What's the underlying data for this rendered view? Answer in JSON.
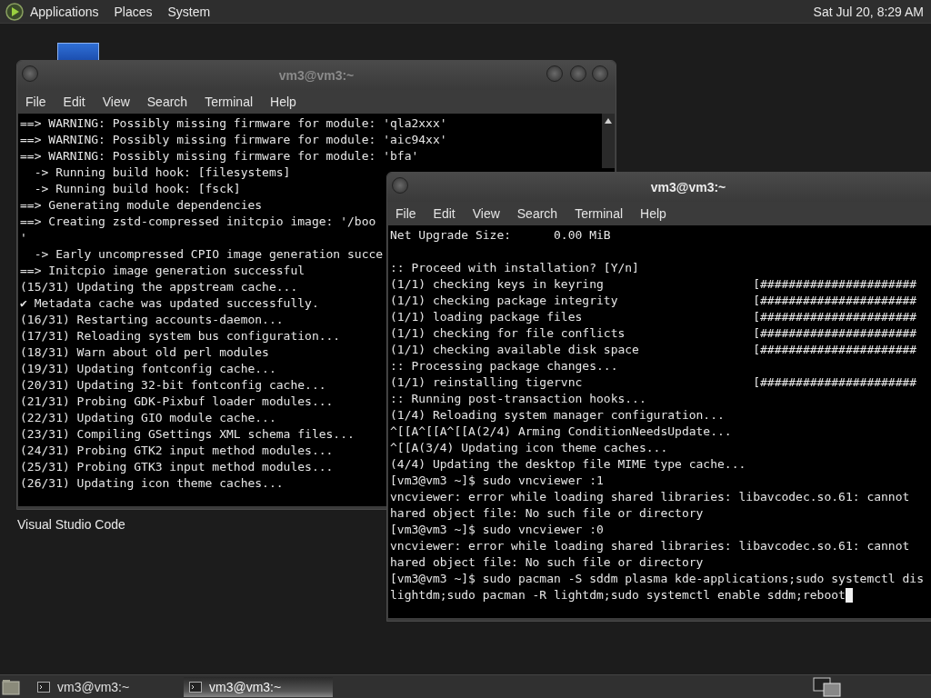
{
  "top_panel": {
    "menus": [
      "Applications",
      "Places",
      "System"
    ],
    "clock": "Sat Jul 20,  8:29 AM"
  },
  "desktop_icons": [
    {
      "label": "Visual Studio Code"
    }
  ],
  "windows": [
    {
      "title": "vm3@vm3:~",
      "active": false,
      "menu": [
        "File",
        "Edit",
        "View",
        "Search",
        "Terminal",
        "Help"
      ],
      "lines": [
        {
          "kind": "text",
          "text": "==> WARNING: Possibly missing firmware for module: 'qla2xxx'"
        },
        {
          "kind": "text",
          "text": "==> WARNING: Possibly missing firmware for module: 'aic94xx'"
        },
        {
          "kind": "text",
          "text": "==> WARNING: Possibly missing firmware for module: 'bfa'"
        },
        {
          "kind": "text",
          "text": "  -> Running build hook: [filesystems]"
        },
        {
          "kind": "text",
          "text": "  -> Running build hook: [fsck]"
        },
        {
          "kind": "text",
          "text": "==> Generating module dependencies"
        },
        {
          "kind": "text",
          "text": "==> Creating zstd-compressed initcpio image: '/boo"
        },
        {
          "kind": "text",
          "text": "'"
        },
        {
          "kind": "text",
          "text": "  -> Early uncompressed CPIO image generation succe"
        },
        {
          "kind": "text",
          "text": "==> Initcpio image generation successful"
        },
        {
          "kind": "text",
          "text": "(15/31) Updating the appstream cache..."
        },
        {
          "kind": "text",
          "text": "✔ Metadata cache was updated successfully."
        },
        {
          "kind": "text",
          "text": "(16/31) Restarting accounts-daemon..."
        },
        {
          "kind": "text",
          "text": "(17/31) Reloading system bus configuration..."
        },
        {
          "kind": "text",
          "text": "(18/31) Warn about old perl modules"
        },
        {
          "kind": "text",
          "text": "(19/31) Updating fontconfig cache..."
        },
        {
          "kind": "text",
          "text": "(20/31) Updating 32-bit fontconfig cache..."
        },
        {
          "kind": "text",
          "text": "(21/31) Probing GDK-Pixbuf loader modules..."
        },
        {
          "kind": "text",
          "text": "(22/31) Updating GIO module cache..."
        },
        {
          "kind": "text",
          "text": "(23/31) Compiling GSettings XML schema files..."
        },
        {
          "kind": "text",
          "text": "(24/31) Probing GTK2 input method modules..."
        },
        {
          "kind": "text",
          "text": "(25/31) Probing GTK3 input method modules..."
        },
        {
          "kind": "text",
          "text": "(26/31) Updating icon theme caches..."
        }
      ]
    },
    {
      "title": "vm3@vm3:~",
      "active": true,
      "menu": [
        "File",
        "Edit",
        "View",
        "Search",
        "Terminal",
        "Help"
      ],
      "lines": [
        {
          "kind": "text",
          "text": "Net Upgrade Size:      0.00 MiB"
        },
        {
          "kind": "blank"
        },
        {
          "kind": "text",
          "text": ":: Proceed with installation? [Y/n]"
        },
        {
          "kind": "progress",
          "text": "(1/1) checking keys in keyring",
          "bar": "[######################"
        },
        {
          "kind": "progress",
          "text": "(1/1) checking package integrity",
          "bar": "[######################"
        },
        {
          "kind": "progress",
          "text": "(1/1) loading package files",
          "bar": "[######################"
        },
        {
          "kind": "progress",
          "text": "(1/1) checking for file conflicts",
          "bar": "[######################"
        },
        {
          "kind": "progress",
          "text": "(1/1) checking available disk space",
          "bar": "[######################"
        },
        {
          "kind": "text",
          "text": ":: Processing package changes..."
        },
        {
          "kind": "progress",
          "text": "(1/1) reinstalling tigervnc",
          "bar": "[######################"
        },
        {
          "kind": "text",
          "text": ":: Running post-transaction hooks..."
        },
        {
          "kind": "text",
          "text": "(1/4) Reloading system manager configuration..."
        },
        {
          "kind": "text",
          "text": "^[[A^[[A^[[A(2/4) Arming ConditionNeedsUpdate..."
        },
        {
          "kind": "text",
          "text": "^[[A(3/4) Updating icon theme caches..."
        },
        {
          "kind": "text",
          "text": "(4/4) Updating the desktop file MIME type cache..."
        },
        {
          "kind": "text",
          "text": "[vm3@vm3 ~]$ sudo vncviewer :1"
        },
        {
          "kind": "text",
          "text": "vncviewer: error while loading shared libraries: libavcodec.so.61: cannot"
        },
        {
          "kind": "text",
          "text": "hared object file: No such file or directory"
        },
        {
          "kind": "text",
          "text": "[vm3@vm3 ~]$ sudo vncviewer :0"
        },
        {
          "kind": "text",
          "text": "vncviewer: error while loading shared libraries: libavcodec.so.61: cannot"
        },
        {
          "kind": "text",
          "text": "hared object file: No such file or directory"
        },
        {
          "kind": "text",
          "text": "[vm3@vm3 ~]$ sudo pacman -S sddm plasma kde-applications;sudo systemctl dis"
        },
        {
          "kind": "cursor",
          "text": "lightdm;sudo pacman -R lightdm;sudo systemctl enable sddm;reboot"
        }
      ]
    }
  ],
  "taskbar": [
    {
      "label": "vm3@vm3:~",
      "selected": false
    },
    {
      "label": "vm3@vm3:~",
      "selected": true
    }
  ]
}
